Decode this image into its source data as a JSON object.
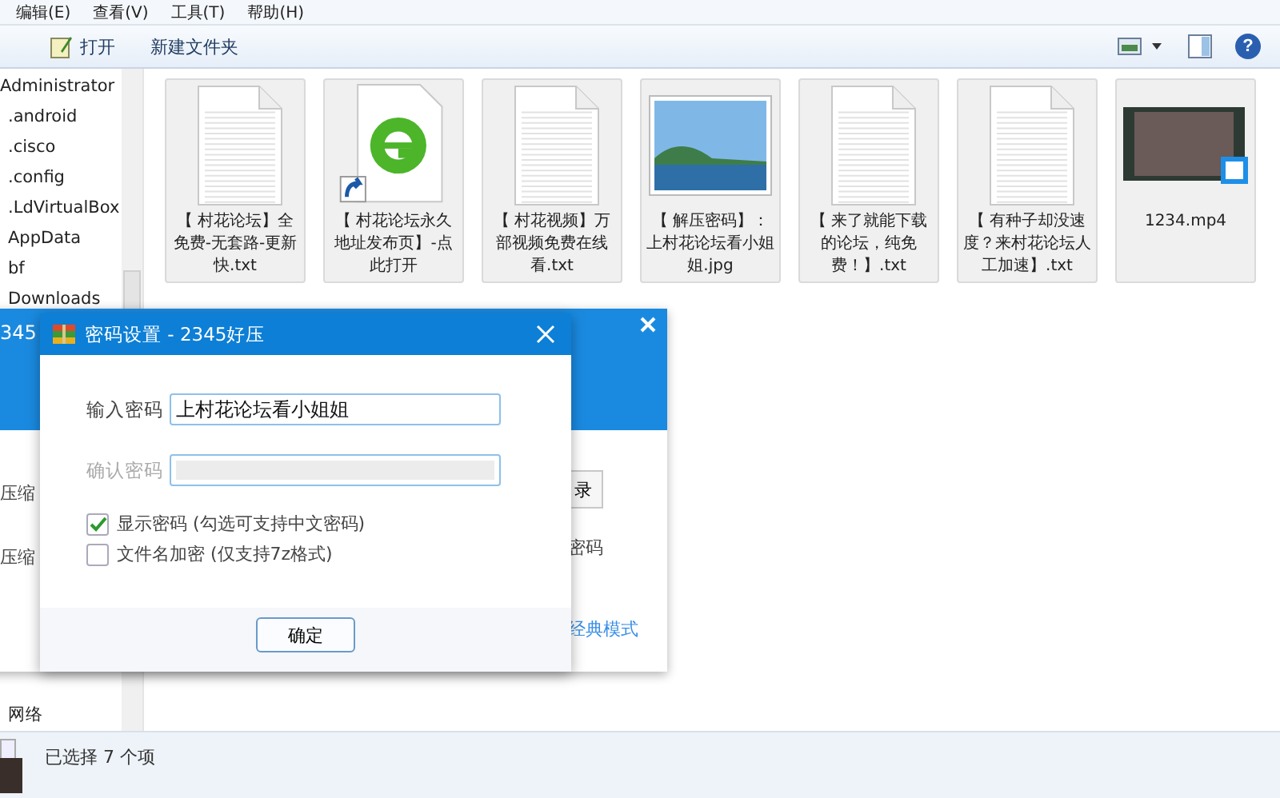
{
  "menu": [
    {
      "label": "编辑(E)"
    },
    {
      "label": "查看(V)"
    },
    {
      "label": "工具(T)"
    },
    {
      "label": "帮助(H)"
    }
  ],
  "toolbar": {
    "buttons": [
      {
        "label": "打开",
        "kind": "open"
      },
      {
        "label": "新建文件夹",
        "kind": "plain"
      }
    ],
    "help": "?"
  },
  "sidebar": {
    "items": [
      {
        "label": "Administrator",
        "kind": "user"
      },
      {
        "label": ".android",
        "kind": "folder"
      },
      {
        "label": ".cisco",
        "kind": "folder"
      },
      {
        "label": ".config",
        "kind": "folder"
      },
      {
        "label": ".LdVirtualBox",
        "kind": "folder"
      },
      {
        "label": "AppData",
        "kind": "folder"
      },
      {
        "label": "bf",
        "kind": "folder"
      },
      {
        "label": "Downloads",
        "kind": "folder"
      }
    ],
    "bottom_items": [
      {
        "label": "网络"
      }
    ]
  },
  "files": [
    {
      "name": "【 村花论坛】全免费-无套路-更新快.txt",
      "kind": "text",
      "selected": true
    },
    {
      "name": "【 村花论坛永久地址发布页】-点此打开",
      "kind": "web-shortcut",
      "selected": true
    },
    {
      "name": "【 村花视频】万部视频免费在线看.txt",
      "kind": "text",
      "selected": true
    },
    {
      "name": "【 解压密码】：上村花论坛看小姐姐.jpg",
      "kind": "image",
      "selected": true
    },
    {
      "name": "【 来了就能下载的论坛，纯免费！】.txt",
      "kind": "text",
      "selected": true
    },
    {
      "name": "【 有种子却没速度？来村花论坛人工加速】.txt",
      "kind": "text",
      "selected": true
    },
    {
      "name": "1234.mp4",
      "kind": "video",
      "selected": true
    }
  ],
  "background_window": {
    "title": "345",
    "left_labels": [
      "压缩",
      "压缩"
    ],
    "button": "录",
    "right_label": "密码",
    "link": "经典模式"
  },
  "dialog": {
    "title": "密码设置 - 2345好压",
    "fields": [
      {
        "label": "输入密码",
        "value": "上村花论坛看小姐姐",
        "disabled": false
      },
      {
        "label": "确认密码",
        "disabled": true
      }
    ],
    "checkboxes": [
      {
        "label": "显示密码 (勾选可支持中文密码)",
        "checked": true
      },
      {
        "label": "文件名加密 (仅支持7z格式)",
        "checked": false
      }
    ],
    "ok_button": "确定"
  },
  "status_bar": {
    "text": "已选择 7 个项"
  }
}
